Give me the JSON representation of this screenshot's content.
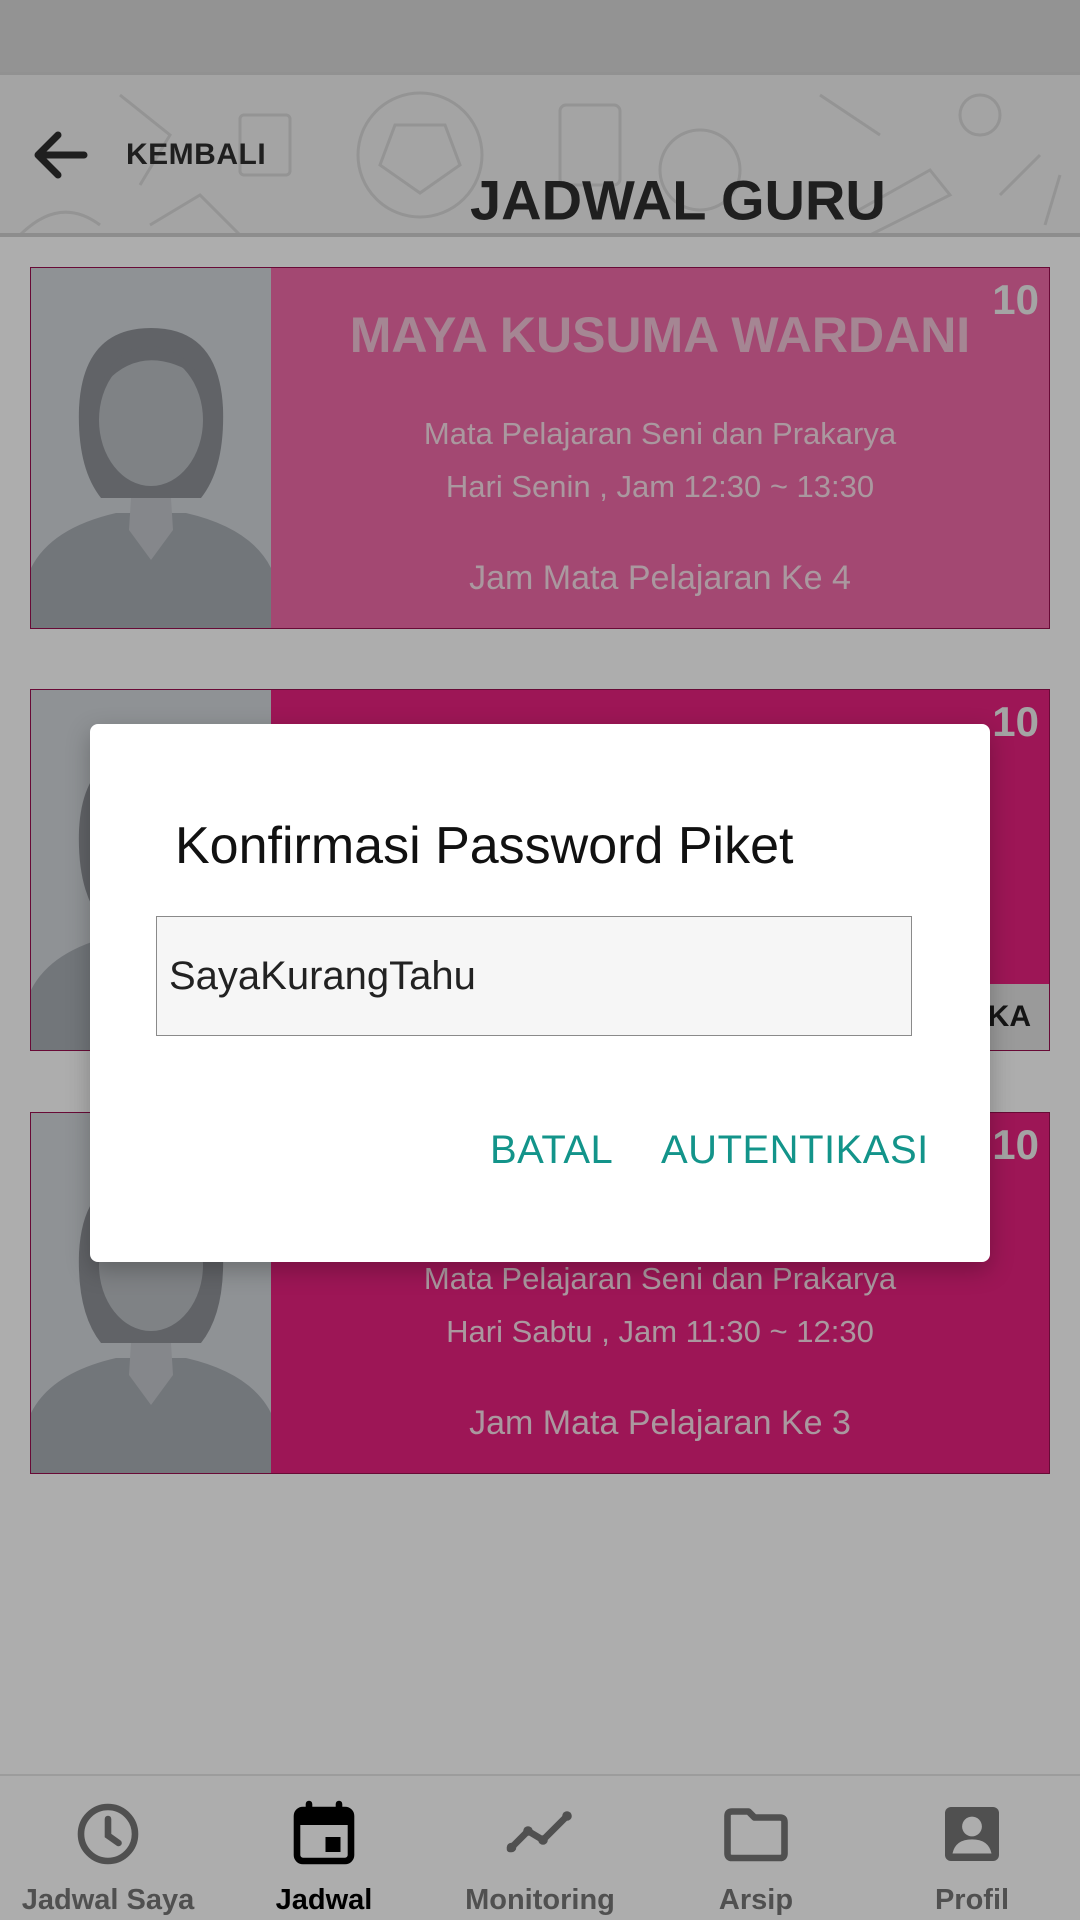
{
  "header": {
    "back_label": "KEMBALI",
    "title": "JADWAL GURU",
    "back_icon": "arrow-back-icon"
  },
  "cards": [
    {
      "class_no": "10",
      "teacher": "MAYA KUSUMA WARDANI",
      "subject": "Mata Pelajaran Seni dan Prakarya",
      "day_time": "Hari Senin , Jam 12:30 ~ 13:30",
      "period": "Jam Mata Pelajaran Ke 4",
      "color": "#f06aa8"
    },
    {
      "class_no": "10",
      "status": "KA",
      "color": "#e8217f"
    },
    {
      "class_no": "10",
      "subject": "Mata Pelajaran Seni dan Prakarya",
      "day_time": "Hari Sabtu , Jam 11:30 ~ 12:30",
      "period": "Jam Mata Pelajaran Ke 3",
      "color": "#e8217f"
    }
  ],
  "dialog": {
    "title": "Konfirmasi Password Piket",
    "input_value": "SayaKurangTahu",
    "cancel_label": "BATAL",
    "ok_label": "AUTENTIKASI",
    "accent": "#13948a"
  },
  "nav": {
    "items": [
      {
        "label": "Jadwal Saya",
        "icon": "clock-icon"
      },
      {
        "label": "Jadwal",
        "icon": "calendar-icon",
        "active": true
      },
      {
        "label": "Monitoring",
        "icon": "trend-line-icon"
      },
      {
        "label": "Arsip",
        "icon": "folder-icon"
      },
      {
        "label": "Profil",
        "icon": "account-box-icon"
      }
    ]
  }
}
